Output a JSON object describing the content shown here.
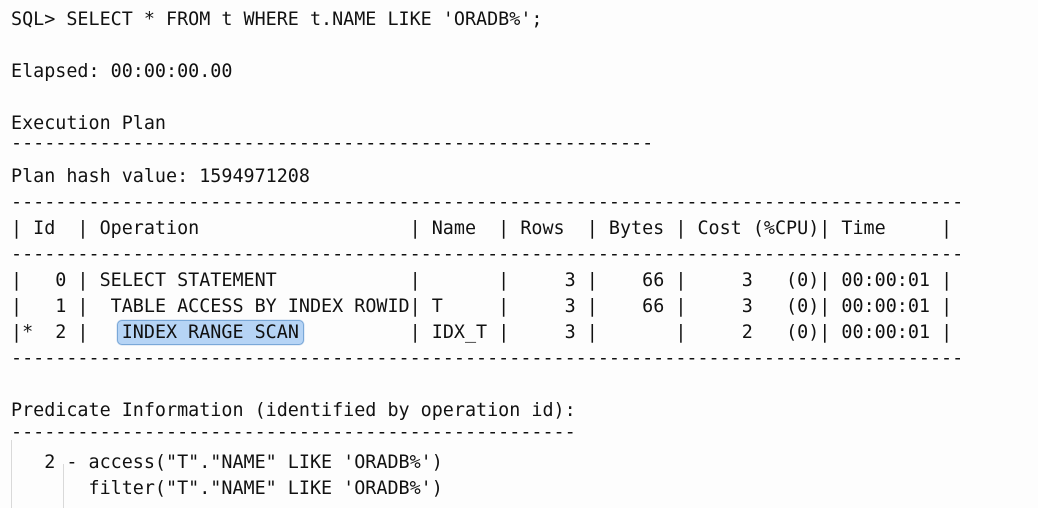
{
  "terminal": {
    "background_color": "#fdfdfd",
    "foreground_color": "#111111",
    "highlight_color": "#b6d4f5",
    "highlight_border_color": "#7aa8d8"
  },
  "prompt_line": "SQL> SELECT * FROM t WHERE t.NAME LIKE 'ORADB%';",
  "elapsed_line": "Elapsed: 00:00:00.00",
  "execution_plan": {
    "heading": "Execution Plan",
    "heading_rule": "----------------------------------------------------------",
    "plan_hash_label": "Plan hash value: 1594971208",
    "table_rule": "--------------------------------------------------------------------------------------",
    "header_row": "| Id  | Operation                   | Name  | Rows  | Bytes | Cost (%CPU)| Time     |",
    "rows": [
      {
        "prefix": "|   0 | ",
        "operation": "SELECT STATEMENT",
        "operation_pad": "            ",
        "suffix": "|       |     3 |    66 |     3   (0)| 00:00:01 |",
        "highlighted": false
      },
      {
        "prefix": "|   1 |  ",
        "operation": "TABLE ACCESS BY INDEX ROWID",
        "operation_pad": "",
        "suffix": "| T     |     3 |    66 |     3   (0)| 00:00:01 |",
        "highlighted": false
      },
      {
        "prefix": "|*  2 |   ",
        "operation": "INDEX RANGE SCAN",
        "operation_pad": "          ",
        "suffix": "| IDX_T |     3 |       |     2   (0)| 00:00:01 |",
        "highlighted": true
      }
    ]
  },
  "predicate_information": {
    "heading": "Predicate Information (identified by operation id):",
    "heading_rule": "---------------------------------------------------",
    "entries": [
      "   2 - access(\"T\".\"NAME\" LIKE 'ORADB%')",
      "       filter(\"T\".\"NAME\" LIKE 'ORADB%')"
    ]
  }
}
